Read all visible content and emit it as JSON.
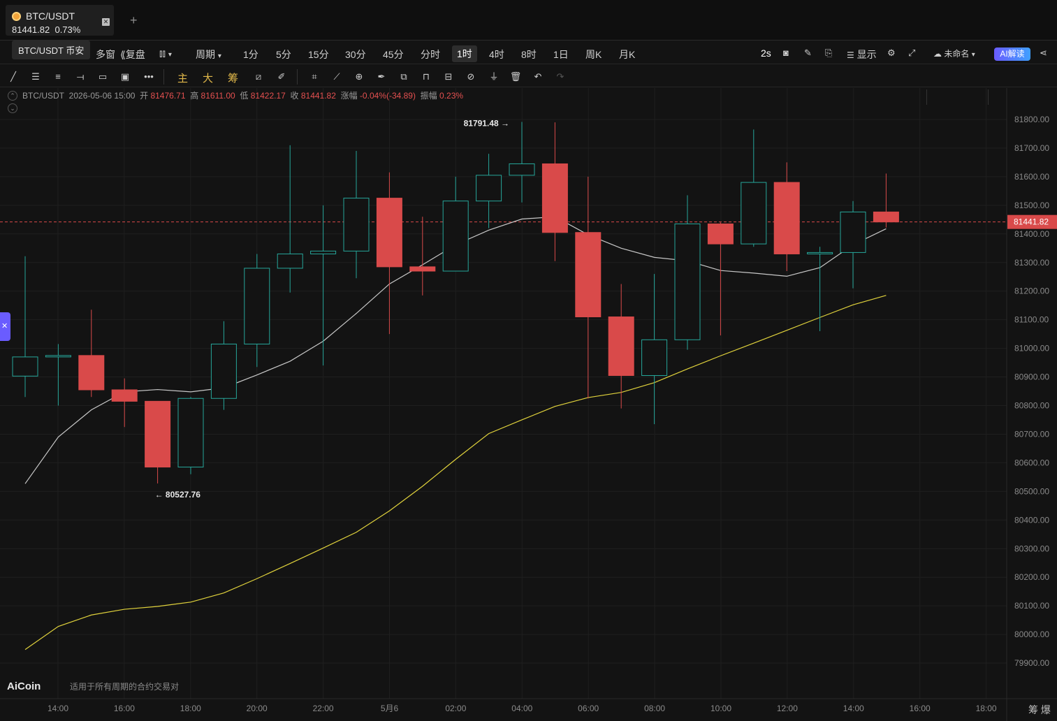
{
  "tab": {
    "symbol": "BTC/USDT",
    "price": "81441.82",
    "change": "0.73%",
    "add": "+"
  },
  "tooltip": "BTC/USDT 币安",
  "toolbar1": {
    "multi_window": "多窗",
    "replay": "复盘",
    "period": "周期",
    "intervals": [
      "1分",
      "5分",
      "15分",
      "30分",
      "45分",
      "分时",
      "1时",
      "4时",
      "8时",
      "1日",
      "周K",
      "月K"
    ],
    "active_interval": "1时",
    "refresh": "2s",
    "display": "显示",
    "layout_name": "未命名",
    "ai": "AI解读"
  },
  "toolbar2": {
    "ind_main": "主",
    "ind_big": "大",
    "ind_chip": "筹"
  },
  "ohlc": {
    "symbol": "BTC/USDT",
    "datetime": "2026-05-06 15:00",
    "open_label": "开",
    "open": "81476.71",
    "high_label": "高",
    "high": "81611.00",
    "low_label": "低",
    "low": "81422.17",
    "close_label": "收",
    "close": "81441.82",
    "change_label": "涨幅",
    "change": "-0.04%(-34.89)",
    "amp_label": "振幅",
    "amp": "0.23%"
  },
  "footer": {
    "logo": "AiCoin",
    "note": "适用于所有周期的合约交易对",
    "corner": "筹 爆"
  },
  "colors": {
    "up": "#26a69a",
    "down": "#d94a4a",
    "ma_short": "#c8c8c8",
    "ma_long": "#e0d23c",
    "price_line": "#d94a4a"
  },
  "chart_data": {
    "type": "candlestick",
    "y_ticks": [
      "81800.00",
      "81700.00",
      "81600.00",
      "81500.00",
      "81400.00",
      "81300.00",
      "81200.00",
      "81100.00",
      "81000.00",
      "80900.00",
      "80800.00",
      "80700.00",
      "80600.00",
      "80500.00",
      "80400.00",
      "80300.00",
      "80200.00",
      "80100.00",
      "80000.00",
      "79900.00"
    ],
    "ylim": [
      79855,
      81855
    ],
    "x_ticks": [
      "14:00",
      "16:00",
      "18:00",
      "20:00",
      "22:00",
      "5月6",
      "02:00",
      "04:00",
      "06:00",
      "08:00",
      "10:00",
      "12:00",
      "14:00",
      "16:00",
      "18:00"
    ],
    "current_price": "81441.82",
    "high_marker": "81791.48",
    "low_marker": "80527.76",
    "candles": [
      {
        "t": "13:00",
        "o": 80903,
        "h": 81322,
        "l": 80830,
        "c": 80970
      },
      {
        "t": "14:00",
        "o": 80970,
        "h": 81015,
        "l": 80800,
        "c": 80975
      },
      {
        "t": "15:00",
        "o": 80975,
        "h": 81135,
        "l": 80830,
        "c": 80855
      },
      {
        "t": "16:00",
        "o": 80855,
        "h": 80895,
        "l": 80725,
        "c": 80815
      },
      {
        "t": "17:00",
        "o": 80815,
        "h": 80815,
        "l": 80527.76,
        "c": 80585
      },
      {
        "t": "18:00",
        "o": 80585,
        "h": 80830,
        "l": 80560,
        "c": 80825
      },
      {
        "t": "19:00",
        "o": 80825,
        "h": 81095,
        "l": 80785,
        "c": 81015
      },
      {
        "t": "20:00",
        "o": 81015,
        "h": 81330,
        "l": 80935,
        "c": 81280
      },
      {
        "t": "21:00",
        "o": 81280,
        "h": 81710,
        "l": 81195,
        "c": 81330
      },
      {
        "t": "22:00",
        "o": 81330,
        "h": 81500,
        "l": 80940,
        "c": 81340
      },
      {
        "t": "23:00",
        "o": 81340,
        "h": 81690,
        "l": 81245,
        "c": 81525
      },
      {
        "t": "00:00",
        "o": 81525,
        "h": 81615,
        "l": 81050,
        "c": 81285
      },
      {
        "t": "01:00",
        "o": 81285,
        "h": 81460,
        "l": 81185,
        "c": 81270
      },
      {
        "t": "02:00",
        "o": 81270,
        "h": 81600,
        "l": 81270,
        "c": 81515
      },
      {
        "t": "03:00",
        "o": 81515,
        "h": 81680,
        "l": 81420,
        "c": 81605
      },
      {
        "t": "04:00",
        "o": 81605,
        "h": 81791.48,
        "l": 81510,
        "c": 81645
      },
      {
        "t": "05:00",
        "o": 81645,
        "h": 81790,
        "l": 81305,
        "c": 81405
      },
      {
        "t": "06:00",
        "o": 81405,
        "h": 81600,
        "l": 80825,
        "c": 81110
      },
      {
        "t": "07:00",
        "o": 81110,
        "h": 81225,
        "l": 80790,
        "c": 80905
      },
      {
        "t": "08:00",
        "o": 80905,
        "h": 81260,
        "l": 80735,
        "c": 81030
      },
      {
        "t": "09:00",
        "o": 81030,
        "h": 81535,
        "l": 80995,
        "c": 81435
      },
      {
        "t": "10:00",
        "o": 81435,
        "h": 81440,
        "l": 81045,
        "c": 81365
      },
      {
        "t": "11:00",
        "o": 81365,
        "h": 81765,
        "l": 81355,
        "c": 81580
      },
      {
        "t": "12:00",
        "o": 81580,
        "h": 81650,
        "l": 81270,
        "c": 81330
      },
      {
        "t": "13:00",
        "o": 81330,
        "h": 81355,
        "l": 81060,
        "c": 81335
      },
      {
        "t": "14:00",
        "o": 81335,
        "h": 81515,
        "l": 81210,
        "c": 81476.71
      },
      {
        "t": "15:00",
        "o": 81476.71,
        "h": 81611,
        "l": 81422.17,
        "c": 81441.82
      }
    ],
    "ma_short": [
      80527,
      80690,
      80785,
      80848,
      80856,
      80848,
      80862,
      80907,
      80955,
      81025,
      81122,
      81225,
      81292,
      81362,
      81413,
      81452,
      81460,
      81397,
      81350,
      81318,
      81306,
      81272,
      81263,
      81252,
      81282,
      81362,
      81418
    ],
    "ma_long": [
      79947,
      80028,
      80068,
      80088,
      80098,
      80113,
      80145,
      80195,
      80248,
      80302,
      80357,
      80432,
      80518,
      80612,
      80702,
      80750,
      80797,
      80828,
      80846,
      80880,
      80928,
      80974,
      81018,
      81063,
      81108,
      81152,
      81185
    ]
  }
}
